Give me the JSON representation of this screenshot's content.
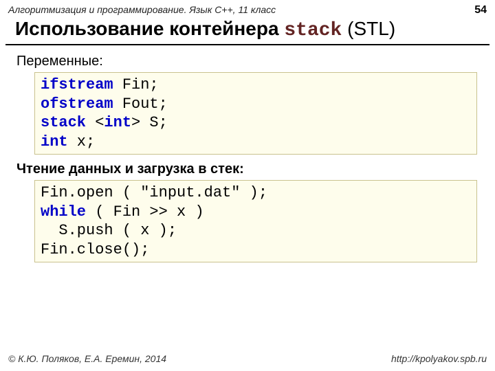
{
  "header": {
    "breadcrumb": "Алгоритмизация и программирование. Язык C++, 11 класс",
    "page_number": "54"
  },
  "title": {
    "prefix": "Использование контейнера ",
    "code": "stack",
    "suffix": " (STL)"
  },
  "section1": {
    "label": "Переменные:",
    "code": {
      "l1_kw": "ifstream",
      "l1_rest": " Fin;",
      "l2_kw": "ofstream",
      "l2_rest": " Fout;",
      "l3_kw1": "stack",
      "l3_mid": " <",
      "l3_kw2": "int",
      "l3_rest": "> S;",
      "l4_kw": "int",
      "l4_rest": " x;"
    }
  },
  "section2": {
    "label": "Чтение данных и загрузка в стек:",
    "code": {
      "l1": "Fin.open ( \"input.dat\" );",
      "l2_kw": "while",
      "l2_rest": " ( Fin >> x )",
      "l3": "  S.push ( x );",
      "l4": "Fin.close();"
    }
  },
  "footer": {
    "copyright": "© К.Ю. Поляков, Е.А. Еремин, 2014",
    "url": "http://kpolyakov.spb.ru"
  }
}
